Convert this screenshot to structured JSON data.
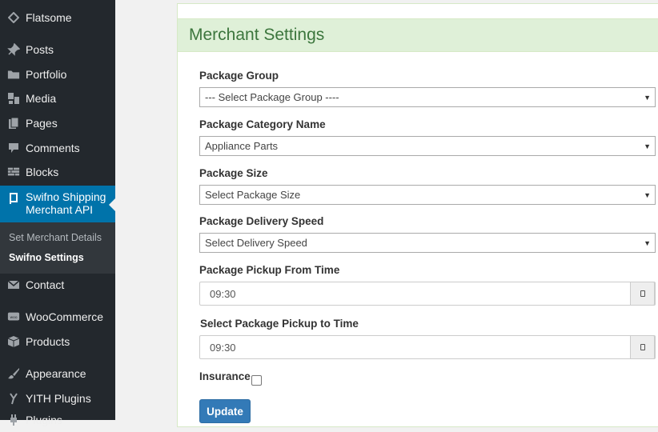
{
  "sidebar": {
    "items": [
      {
        "label": "Flatsome",
        "icon": "flatsome-diamond-icon"
      },
      {
        "label": "Posts",
        "icon": "pin-icon"
      },
      {
        "label": "Portfolio",
        "icon": "folder-icon"
      },
      {
        "label": "Media",
        "icon": "media-icon"
      },
      {
        "label": "Pages",
        "icon": "pages-icon"
      },
      {
        "label": "Comments",
        "icon": "comment-icon"
      },
      {
        "label": "Blocks",
        "icon": "blocks-icon"
      },
      {
        "label": "Swifno Shipping Merchant API",
        "icon": "book-icon"
      },
      {
        "label": "Contact",
        "icon": "mail-icon"
      },
      {
        "label": "WooCommerce",
        "icon": "woo-icon"
      },
      {
        "label": "Products",
        "icon": "cube-icon"
      },
      {
        "label": "Appearance",
        "icon": "brush-icon"
      },
      {
        "label": "YITH Plugins",
        "icon": "yith-icon"
      },
      {
        "label": "Plugins",
        "icon": "plug-icon"
      }
    ],
    "submenu": [
      {
        "label": "Set Merchant Details"
      },
      {
        "label": "Swifno Settings"
      }
    ]
  },
  "panel": {
    "title": "Merchant Settings"
  },
  "form": {
    "package_group": {
      "label": "Package Group",
      "value": "--- Select Package Group ----"
    },
    "package_category": {
      "label": "Package Category Name",
      "value": "Appliance Parts"
    },
    "package_size": {
      "label": "Package Size",
      "value": "Select Package Size"
    },
    "delivery_speed": {
      "label": "Package Delivery Speed",
      "value": "Select Delivery Speed"
    },
    "pickup_from": {
      "label": "Package Pickup From Time",
      "value": "09:30"
    },
    "pickup_to": {
      "label": "Select Package Pickup to Time",
      "value": "09:30"
    },
    "insurance": {
      "label": "Insurance",
      "checked": false
    },
    "update_label": "Update"
  },
  "colors": {
    "sidebar_bg": "#23282d",
    "accent": "#0073aa",
    "panel_heading_bg": "#dff0d8",
    "panel_heading_text": "#3c763d",
    "button_primary": "#337ab7"
  }
}
